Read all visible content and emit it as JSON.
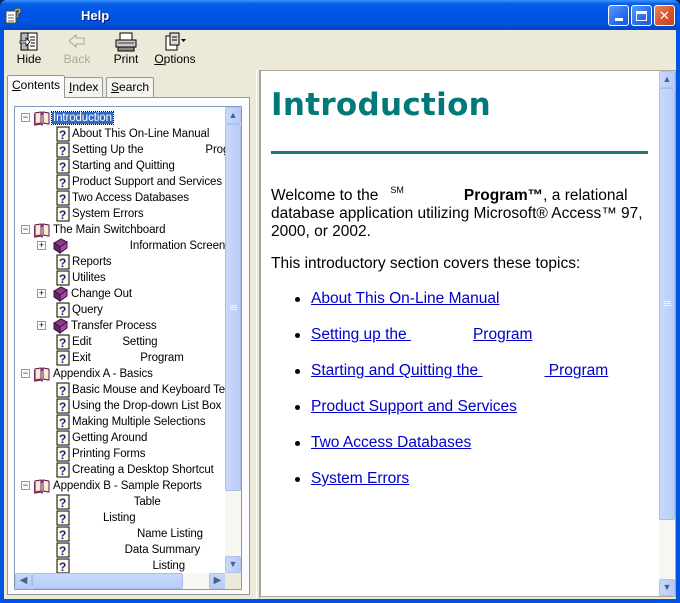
{
  "window": {
    "title": "Help",
    "controls": {
      "minimize": "minimize",
      "maximize": "maximize",
      "close": "close"
    }
  },
  "toolbar": {
    "hide": {
      "label": "Hide",
      "icon": "hide-pane-icon",
      "enabled": true
    },
    "back": {
      "label": "Back",
      "icon": "back-arrow-icon",
      "enabled": false
    },
    "print": {
      "label": "Print",
      "icon": "printer-icon",
      "enabled": true
    },
    "options": {
      "label_underlined": "O",
      "label_rest": "ptions",
      "icon": "options-icon",
      "enabled": true
    }
  },
  "tabs": {
    "contents": {
      "underlined": "C",
      "rest": "ontents",
      "active": true
    },
    "index": {
      "pre": "",
      "underlined": "I",
      "rest": "ndex"
    },
    "search": {
      "underlined": "S",
      "rest": "earch"
    }
  },
  "tree": {
    "nodes": [
      {
        "label": "Introduction",
        "level": 0,
        "type": "book-open",
        "expander": "−",
        "selected": true
      },
      {
        "label": "About This On-Line Manual",
        "level": 2,
        "type": "page"
      },
      {
        "label": "Setting Up the                    Progra",
        "level": 2,
        "type": "page"
      },
      {
        "label": "Starting and Quitting",
        "level": 2,
        "type": "page"
      },
      {
        "label": "Product Support and Services",
        "level": 2,
        "type": "page"
      },
      {
        "label": "Two Access Databases",
        "level": 2,
        "type": "page"
      },
      {
        "label": "System Errors",
        "level": 2,
        "type": "page"
      },
      {
        "label": "The Main Switchboard",
        "level": 0,
        "type": "book-open",
        "expander": "−"
      },
      {
        "label": "                   Information Screen",
        "level": 1,
        "type": "book-closed",
        "expander": "+"
      },
      {
        "label": "Reports",
        "level": 2,
        "type": "page"
      },
      {
        "label": "Utilites",
        "level": 2,
        "type": "page"
      },
      {
        "label": "Change Out",
        "level": 1,
        "type": "book-closed",
        "expander": "+"
      },
      {
        "label": "Query",
        "level": 2,
        "type": "page"
      },
      {
        "label": "Transfer Process",
        "level": 1,
        "type": "book-closed",
        "expander": "+"
      },
      {
        "label": "Edit          Setting",
        "level": 2,
        "type": "page"
      },
      {
        "label": "Exit                Program",
        "level": 2,
        "type": "page"
      },
      {
        "label": "Appendix A - Basics",
        "level": 0,
        "type": "book-open",
        "expander": "−"
      },
      {
        "label": "Basic Mouse and Keyboard Te",
        "level": 2,
        "type": "page"
      },
      {
        "label": "Using the Drop-down List Box",
        "level": 2,
        "type": "page"
      },
      {
        "label": "Making Multiple Selections",
        "level": 2,
        "type": "page"
      },
      {
        "label": "Getting Around",
        "level": 2,
        "type": "page"
      },
      {
        "label": "Printing Forms",
        "level": 2,
        "type": "page"
      },
      {
        "label": "Creating a Desktop Shortcut",
        "level": 2,
        "type": "page"
      },
      {
        "label": "Appendix B - Sample Reports",
        "level": 0,
        "type": "book-open",
        "expander": "−"
      },
      {
        "label": "                    Table",
        "level": 2,
        "type": "page"
      },
      {
        "label": "          Listing",
        "level": 2,
        "type": "page"
      },
      {
        "label": "                     Name Listing",
        "level": 2,
        "type": "page"
      },
      {
        "label": "                 Data Summary",
        "level": 2,
        "type": "page"
      },
      {
        "label": "                          Listing",
        "level": 2,
        "type": "page"
      }
    ]
  },
  "document": {
    "title": "Introduction",
    "welcome_pre": "Welcome to the",
    "welcome_sm": "SM",
    "welcome_program": "Program™",
    "welcome_post": ", a relational database application utilizing Microsoft® Access™ 97, 2000, or 2002.",
    "intro_topics": "This introductory section covers these topics:",
    "topics": [
      {
        "pre": "About This On-Line Manual",
        "post": ""
      },
      {
        "pre": "Setting up the ",
        "post": "Program"
      },
      {
        "pre": "Starting and Quitting the ",
        "post": " Program"
      },
      {
        "pre": "Product Support and Services",
        "post": ""
      },
      {
        "pre": "Two Access Databases",
        "post": ""
      },
      {
        "pre": "System Errors",
        "post": ""
      }
    ],
    "link_color": "#0000cc",
    "title_color": "#007a78"
  }
}
